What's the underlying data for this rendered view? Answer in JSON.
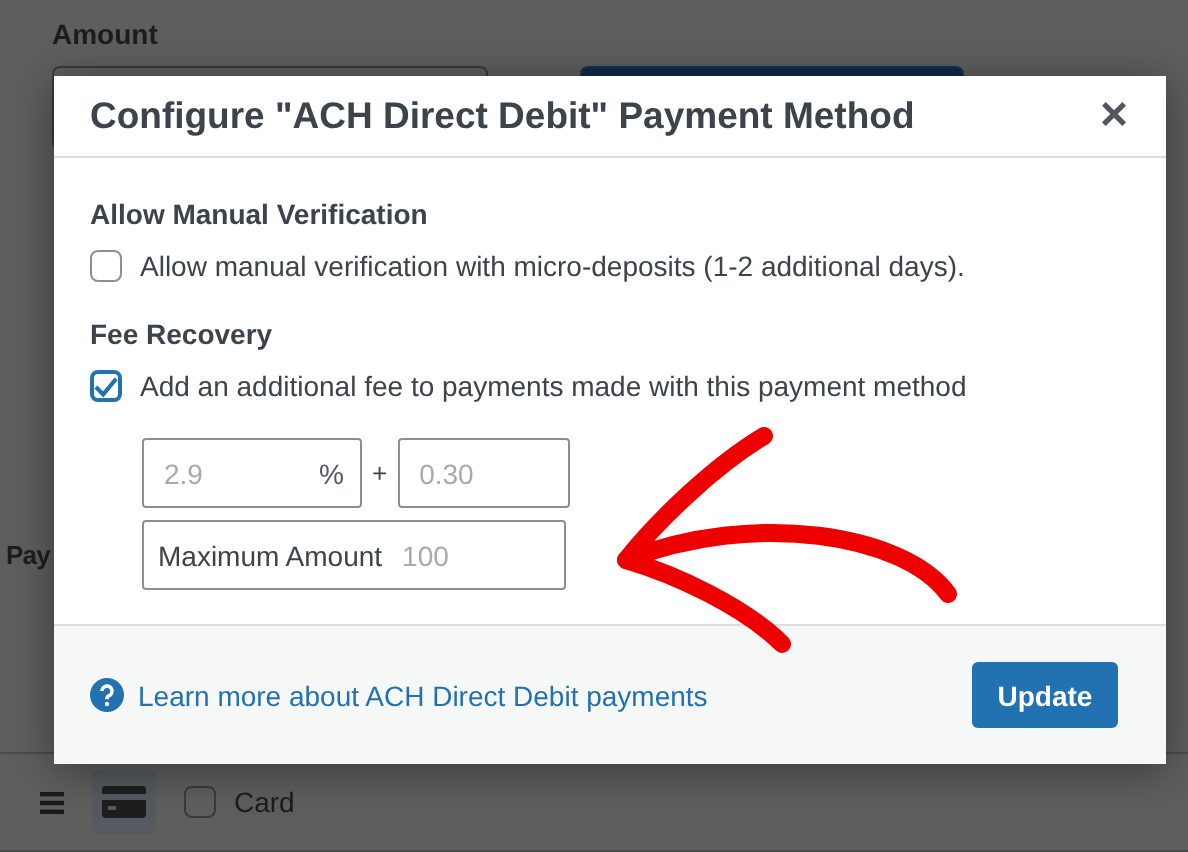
{
  "background": {
    "amount_label": "Amount",
    "section_label": "Pay",
    "row": {
      "label": "Card",
      "checked": false
    }
  },
  "dialog": {
    "title": "Configure \"ACH Direct Debit\" Payment Method",
    "close": "×",
    "sections": [
      {
        "heading": "Allow Manual Verification",
        "checkbox": {
          "label": "Allow manual verification with micro-deposits (1-2 additional days).",
          "checked": false
        }
      },
      {
        "heading": "Fee Recovery",
        "checkbox": {
          "label": "Add an additional fee to payments made with this payment method",
          "checked": true
        }
      }
    ],
    "fee": {
      "percent": {
        "placeholder": "2.9",
        "suffix": "%"
      },
      "plus": "+",
      "fixed": {
        "placeholder": "0.30"
      },
      "maximum": {
        "prefix": "Maximum Amount",
        "placeholder": "100"
      }
    },
    "footer": {
      "link": "Learn more about ACH Direct Debit payments",
      "button": "Update"
    }
  }
}
